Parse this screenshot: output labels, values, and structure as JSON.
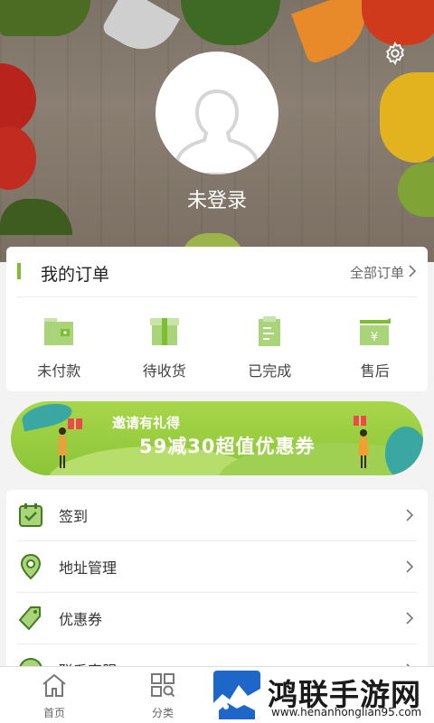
{
  "profile": {
    "login_status": "未登录"
  },
  "orders": {
    "title": "我的订单",
    "all_link": "全部订单",
    "items": [
      {
        "label": "未付款",
        "icon": "wallet-icon"
      },
      {
        "label": "待收货",
        "icon": "package-icon"
      },
      {
        "label": "已完成",
        "icon": "document-check-icon"
      },
      {
        "label": "售后",
        "icon": "refund-icon"
      }
    ]
  },
  "banner": {
    "line1": "邀请有礼得",
    "line2": "59减30超值优惠券"
  },
  "menu": {
    "items": [
      {
        "label": "签到",
        "icon": "calendar-check-icon"
      },
      {
        "label": "地址管理",
        "icon": "location-pin-icon"
      },
      {
        "label": "优惠券",
        "icon": "tag-icon"
      },
      {
        "label": "联系客服",
        "icon": "service-icon"
      }
    ]
  },
  "tabbar": {
    "items": [
      {
        "label": "首页",
        "icon": "home-icon"
      },
      {
        "label": "分类",
        "icon": "category-icon"
      }
    ]
  },
  "watermark": {
    "title": "鸿联手游网",
    "url": "www.henanhonglian95.com"
  },
  "colors": {
    "accent_green": "#7cbf32",
    "icon_dark_green": "#3f7d1f",
    "banner_green": "#9ccf45",
    "watermark_blue": "#1f66c9"
  }
}
